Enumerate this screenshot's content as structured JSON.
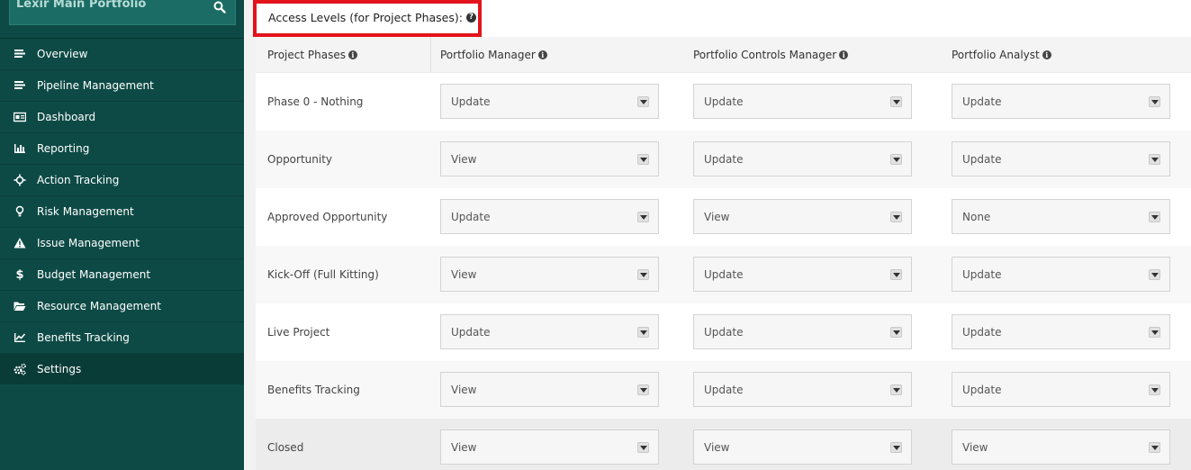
{
  "sidebar": {
    "portfolio_title": "Lexir Main Portfolio",
    "search_icon": "search-icon",
    "items": [
      {
        "label": "Overview",
        "icon": "align-left-icon"
      },
      {
        "label": "Pipeline Management",
        "icon": "align-left-icon"
      },
      {
        "label": "Dashboard",
        "icon": "id-card-icon"
      },
      {
        "label": "Reporting",
        "icon": "bar-chart-icon"
      },
      {
        "label": "Action Tracking",
        "icon": "crosshair-icon"
      },
      {
        "label": "Risk Management",
        "icon": "lightbulb-icon"
      },
      {
        "label": "Issue Management",
        "icon": "warning-icon"
      },
      {
        "label": "Budget Management",
        "icon": "dollar-icon"
      },
      {
        "label": "Resource Management",
        "icon": "folder-open-icon"
      },
      {
        "label": "Benefits Tracking",
        "icon": "line-chart-icon"
      },
      {
        "label": "Settings",
        "icon": "cogs-icon",
        "active": true
      }
    ]
  },
  "main": {
    "heading": "Access Levels (for Project Phases):",
    "columns": [
      "Project Phases",
      "Portfolio Manager",
      "Portfolio Controls Manager",
      "Portfolio Analyst"
    ],
    "rows": [
      {
        "phase": "Phase 0 - Nothing",
        "values": [
          "Update",
          "Update",
          "Update"
        ]
      },
      {
        "phase": "Opportunity",
        "values": [
          "View",
          "Update",
          "Update"
        ]
      },
      {
        "phase": "Approved Opportunity",
        "values": [
          "Update",
          "View",
          "None"
        ]
      },
      {
        "phase": "Kick-Off (Full Kitting)",
        "values": [
          "View",
          "Update",
          "Update"
        ]
      },
      {
        "phase": "Live Project",
        "values": [
          "Update",
          "Update",
          "Update"
        ]
      },
      {
        "phase": "Benefits Tracking",
        "values": [
          "View",
          "Update",
          "Update"
        ]
      },
      {
        "phase": "Closed",
        "values": [
          "View",
          "View",
          "View"
        ]
      }
    ]
  },
  "colors": {
    "sidebar_bg": "#0d4a45",
    "highlight_border": "#e3131b"
  }
}
